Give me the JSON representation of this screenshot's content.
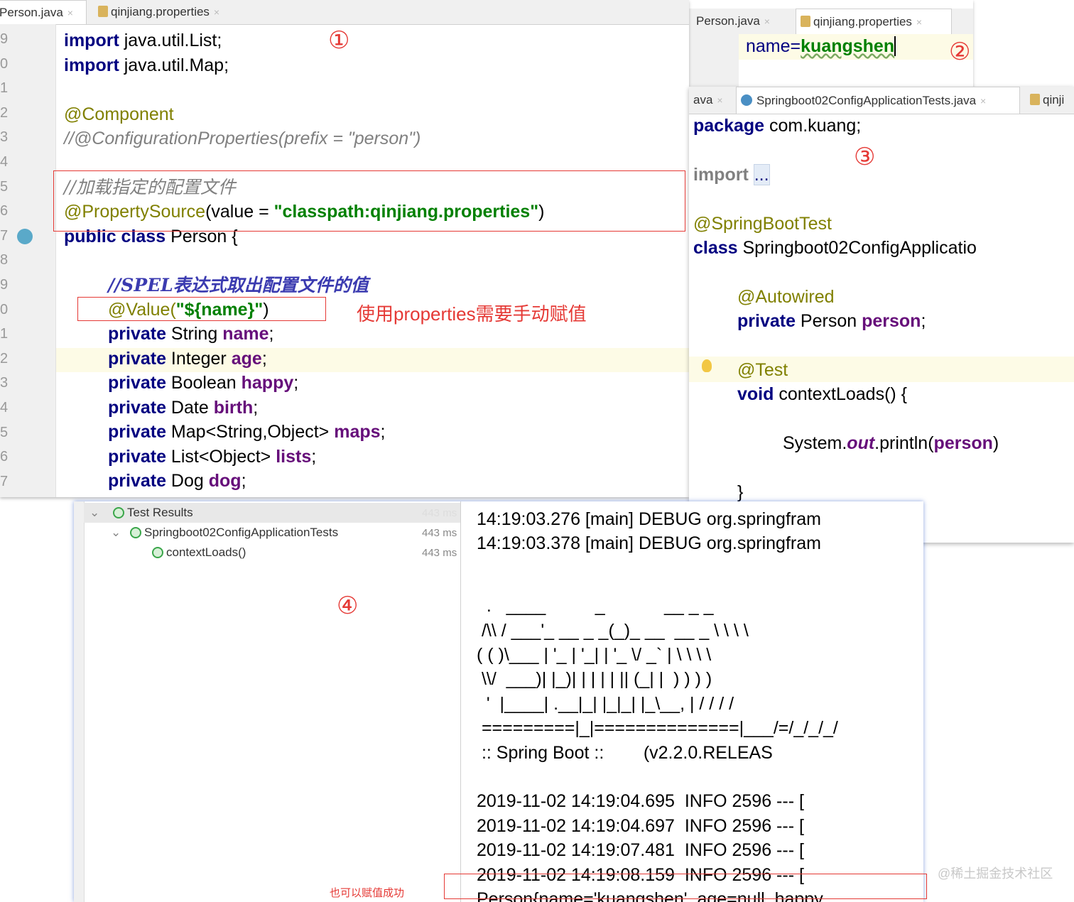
{
  "panel1": {
    "tabs": [
      {
        "label": "Person.java",
        "close": "×"
      },
      {
        "label": "qinjiang.properties",
        "close": "×"
      }
    ],
    "line_numbers": [
      "9",
      "0",
      "1",
      "2",
      "3",
      "4",
      "5",
      "6",
      "7",
      "8",
      "9",
      "0",
      "1",
      "2",
      "3",
      "4",
      "5",
      "6",
      "7"
    ],
    "code": {
      "import_kw": "import",
      "import_list": " java.util.List;",
      "import_map": " java.util.Map;",
      "component": "@Component",
      "config_props": "//@ConfigurationProperties(prefix = \"person\")",
      "comment_cn": "//加载指定的配置文件",
      "propsrc_ann": "@PropertySource",
      "propsrc_open": "(value = ",
      "propsrc_str": "\"classpath:qinjiang.properties\"",
      "propsrc_close": ")",
      "public_kw": "public class",
      "class_name": " Person {",
      "spel_comment": "//SPEL表达式取出配置文件的值",
      "value_ann": "@Value(",
      "value_str": "\"${name}\"",
      "value_close": ")",
      "fields": [
        {
          "kw": "private",
          "type": " String ",
          "name": "name",
          "end": ";"
        },
        {
          "kw": "private",
          "type": " Integer ",
          "name": "age",
          "end": ";"
        },
        {
          "kw": "private",
          "type": " Boolean ",
          "name": "happy",
          "end": ";"
        },
        {
          "kw": "private",
          "type": " Date ",
          "name": "birth",
          "end": ";"
        },
        {
          "kw": "private",
          "type": " Map<String,Object> ",
          "name": "maps",
          "end": ";"
        },
        {
          "kw": "private",
          "type": " List<Object> ",
          "name": "lists",
          "end": ";"
        },
        {
          "kw": "private",
          "type": " Dog ",
          "name": "dog",
          "end": ";"
        }
      ]
    },
    "marker": "①",
    "note": "使用properties需要手动赋值"
  },
  "panel2": {
    "tabs": [
      {
        "label": "Person.java",
        "close": "×"
      },
      {
        "label": "qinjiang.properties",
        "close": "×"
      }
    ],
    "key": "name=",
    "value": "kuangshen",
    "marker": "②"
  },
  "panel3": {
    "tabs": [
      {
        "label": "ava",
        "close": "×"
      },
      {
        "label": "Springboot02ConfigApplicationTests.java",
        "close": "×"
      },
      {
        "label": "qinji"
      }
    ],
    "package_kw": "package",
    "package_name": " com.kuang;",
    "import_kw": "import",
    "import_fold": "...",
    "boot_test": "@SpringBootTest",
    "class_kw": "class",
    "class_name": " Springboot02ConfigApplicatio",
    "autowired": "@Autowired",
    "private_kw": "private",
    "person_type": " Person ",
    "person_field": "person",
    "semi": ";",
    "test_ann": "@Test",
    "void_kw": "void",
    "method": " contextLoads() {",
    "println_pre": "System.",
    "println_out": "out",
    "println_mid": ".println(",
    "println_arg": "person",
    "println_end": ")",
    "close_brace": "}",
    "marker": "③"
  },
  "panel4": {
    "tree": {
      "root": {
        "label": "Test Results",
        "time": "443 ms"
      },
      "suite": {
        "label": "Springboot02ConfigApplicationTests",
        "time": "443 ms"
      },
      "test": {
        "label": "contextLoads()",
        "time": "443 ms"
      }
    },
    "marker": "④",
    "console": {
      "debug_lines": [
        "14:19:03.276 [main] DEBUG org.springfram",
        "14:19:03.378 [main] DEBUG org.springfram"
      ],
      "banner": [
        "  .   ____          _            __ _ _",
        " /\\\\ / ___'_ __ _ _(_)_ __  __ _ \\ \\ \\ \\",
        "( ( )\\___ | '_ | '_| | '_ \\/ _` | \\ \\ \\ \\",
        " \\\\/  ___)| |_)| | | | | || (_| |  ) ) ) )",
        "  '  |____| .__|_| |_|_| |_\\__, | / / / /",
        " =========|_|==============|___/=/_/_/_/",
        " :: Spring Boot ::        (v2.2.0.RELEAS"
      ],
      "info_lines": [
        "2019-11-02 14:19:04.695  INFO 2596 --- [",
        "2019-11-02 14:19:04.697  INFO 2596 --- [",
        "2019-11-02 14:19:07.481  INFO 2596 --- [",
        "2019-11-02 14:19:08.159  INFO 2596 --- ["
      ],
      "result_line": "Person{name='kuangshen', age=null, happy"
    },
    "success_note": "也可以赋值成功"
  },
  "watermark": "@稀土掘金技术社区",
  "colors": {
    "keyword": "#000080",
    "annotation": "#808000",
    "string": "#008000",
    "field": "#660e7a",
    "comment": "#808080",
    "annotation_red": "#e53935",
    "pass_green": "#3aa64a"
  }
}
